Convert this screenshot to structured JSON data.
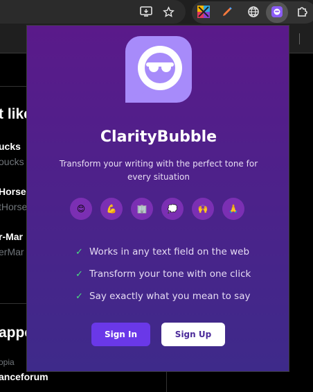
{
  "popup": {
    "title": "ClarityBubble",
    "subtitle": "Transform your writing with the perfect tone for every situation",
    "tones": [
      {
        "icon": "smiling-face-icon",
        "glyph": "😊"
      },
      {
        "icon": "flexed-biceps-icon",
        "glyph": "💪"
      },
      {
        "icon": "office-building-icon",
        "glyph": "🏢"
      },
      {
        "icon": "speech-bubble-icon",
        "glyph": "💭"
      },
      {
        "icon": "raising-hands-icon",
        "glyph": "🙌"
      },
      {
        "icon": "folded-hands-icon",
        "glyph": "🙏"
      }
    ],
    "features": [
      "Works in any text field on the web",
      "Transform your tone with one click",
      "Say exactly what you mean to say"
    ],
    "check_glyph": "✓",
    "sign_in_label": "Sign In",
    "sign_up_label": "Sign Up"
  },
  "background_page": {
    "heading_1": "t like",
    "item_1_name": "ucks",
    "item_1_handle": "oucks",
    "item_2_name": "Horse",
    "item_2_handle": "tHorse",
    "item_3_name": "r-Mar",
    "item_3_handle": "erMar",
    "heading_2": "appe",
    "item_4_sub": "opia",
    "item_4_name": "anceforum"
  },
  "colors": {
    "popup_top": "#5a1a8a",
    "popup_bottom": "#3e2a8a",
    "sign_in_bg": "#6a38e8",
    "check": "#4ade80"
  }
}
